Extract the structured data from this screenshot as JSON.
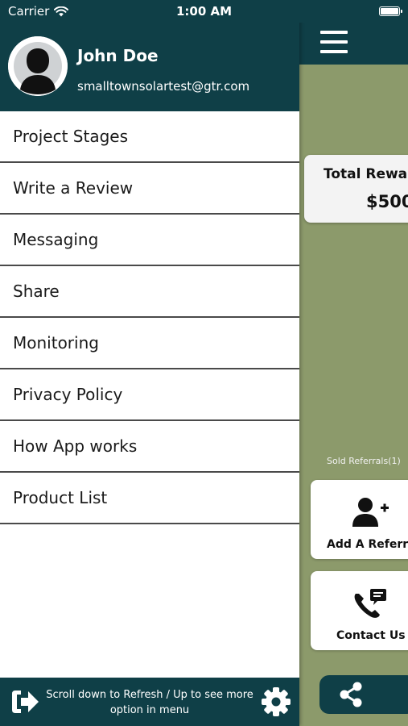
{
  "status_bar": {
    "carrier": "Carrier",
    "time": "1:00 AM",
    "wifi_icon": "wifi-icon",
    "battery_icon": "battery-icon"
  },
  "background_app": {
    "menu_icon": "hamburger-menu-icon",
    "rewards": {
      "title": "Total Rewar",
      "value": "$500"
    },
    "sold_referrals": "Sold Referrals(1)",
    "add_referral": {
      "label": "Add A Referra",
      "icon": "add-user-icon"
    },
    "contact_us": {
      "label": "Contact Us",
      "icon": "phone-message-icon"
    },
    "share_icon": "share-icon"
  },
  "drawer": {
    "user": {
      "name": "John Doe",
      "email": "smalltownsolartest@gtr.com",
      "avatar_icon": "user-avatar-icon"
    },
    "menu": [
      {
        "label": "Project Stages"
      },
      {
        "label": "Write a Review"
      },
      {
        "label": "Messaging"
      },
      {
        "label": "Share"
      },
      {
        "label": "Monitoring"
      },
      {
        "label": "Privacy Policy"
      },
      {
        "label": "How App works"
      },
      {
        "label": "Product List"
      }
    ],
    "footer": {
      "text": "Scroll down to Refresh / Up to see more option in menu",
      "logout_icon": "logout-icon",
      "settings_icon": "gear-icon"
    }
  },
  "colors": {
    "header_bg": "#0f3f47",
    "backdrop": "#8c9a6b",
    "drawer_bg": "#ffffff",
    "divider": "#4a4a4a"
  }
}
